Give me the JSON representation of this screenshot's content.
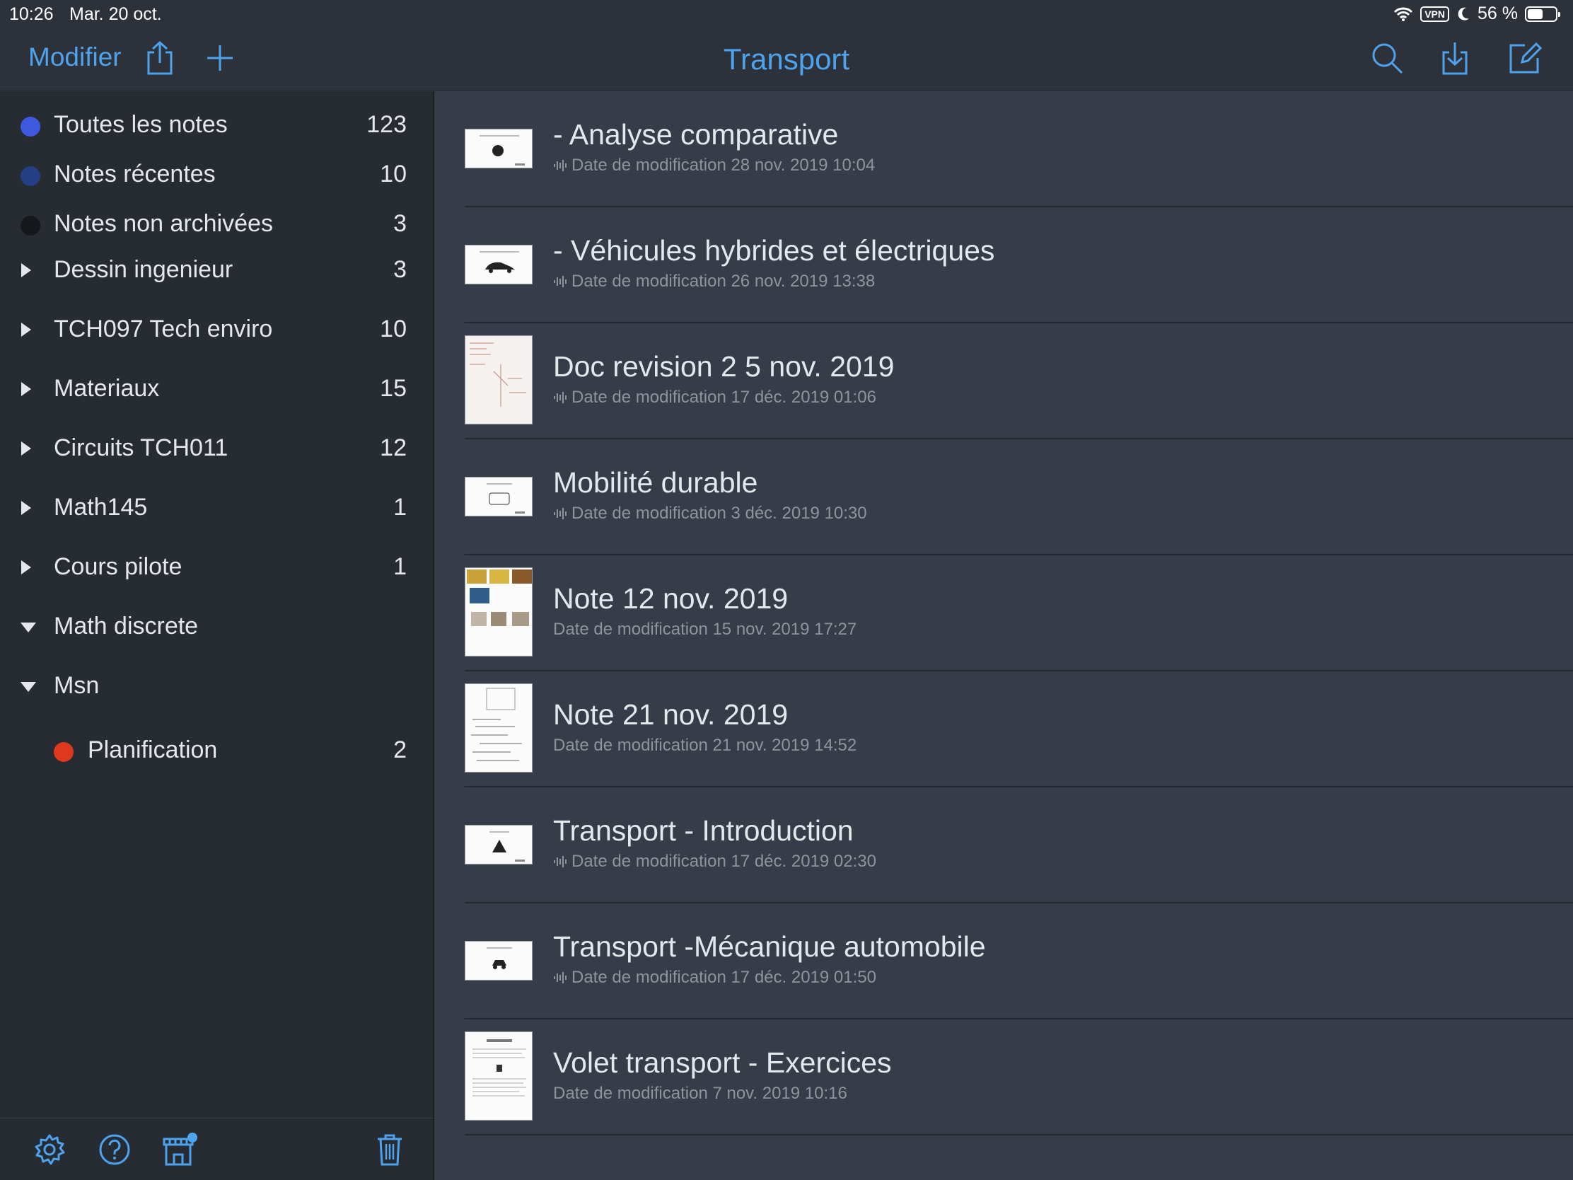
{
  "status": {
    "time": "10:26",
    "date": "Mar. 20 oct.",
    "vpn": "VPN",
    "battery": "56 %",
    "battery_level": 0.56
  },
  "navbar": {
    "edit_label": "Modifier",
    "title": "Transport",
    "accent": "#4da3ee"
  },
  "sidebar": {
    "items": [
      {
        "label": "Toutes les notes",
        "count": "123",
        "color": "#3d59e0"
      },
      {
        "label": "Notes récentes",
        "count": "10",
        "color": "#243f86"
      },
      {
        "label": "Notes non archivées",
        "count": "3",
        "color": "#15171b"
      },
      {
        "label": "Dessin ingenieur",
        "count": "3"
      },
      {
        "label": "TCH097 Tech enviro",
        "count": "10"
      },
      {
        "label": "Materiaux",
        "count": "15"
      },
      {
        "label": "Circuits TCH011",
        "count": "12"
      },
      {
        "label": "Math145",
        "count": "1"
      },
      {
        "label": "Cours pilote",
        "count": "1"
      },
      {
        "label": "Math discrete",
        "count": ""
      },
      {
        "label": "Msn",
        "count": ""
      },
      {
        "label": "Planification",
        "count": "2",
        "color": "#e0371f"
      }
    ]
  },
  "notes": [
    {
      "title": "- Analyse comparative",
      "subtitle": "Date de modification 28 nov. 2019 10:04",
      "audio": true,
      "thumb": "wide"
    },
    {
      "title": "- Véhicules hybrides et électriques",
      "subtitle": "Date de modification 26 nov. 2019 13:38",
      "audio": true,
      "thumb": "wide"
    },
    {
      "title": "Doc revision 2 5 nov. 2019",
      "subtitle": "Date de modification 17 déc. 2019 01:06",
      "audio": true,
      "thumb": "tall"
    },
    {
      "title": "Mobilité durable",
      "subtitle": "Date de modification 3 déc. 2019 10:30",
      "audio": true,
      "thumb": "wide"
    },
    {
      "title": "Note 12 nov. 2019",
      "subtitle": "Date de modification 15 nov. 2019 17:27",
      "audio": false,
      "thumb": "tall"
    },
    {
      "title": "Note 21 nov. 2019",
      "subtitle": "Date de modification 21 nov. 2019 14:52",
      "audio": false,
      "thumb": "tall"
    },
    {
      "title": "Transport - Introduction",
      "subtitle": "Date de modification 17 déc. 2019 02:30",
      "audio": true,
      "thumb": "wide"
    },
    {
      "title": "Transport -Mécanique automobile",
      "subtitle": "Date de modification 17 déc. 2019 01:50",
      "audio": true,
      "thumb": "wide"
    },
    {
      "title": "Volet transport - Exercices",
      "subtitle": "Date de modification 7 nov. 2019 10:16",
      "audio": false,
      "thumb": "tall"
    }
  ]
}
